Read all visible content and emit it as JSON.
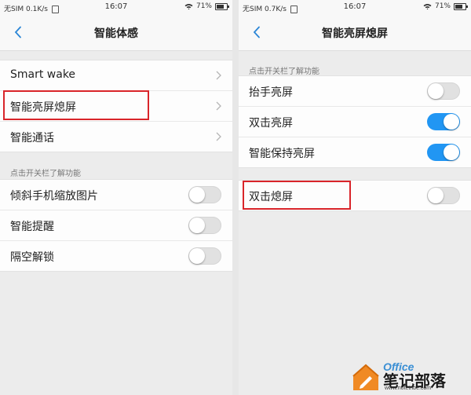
{
  "left_screen": {
    "status": {
      "carrier": "无SIM",
      "speed": "0.1K/s",
      "time": "16:07",
      "battery": "71%",
      "battery_level": 0.71
    },
    "title": "智能体感",
    "nav_items": [
      {
        "label": "Smart wake"
      },
      {
        "label": "智能亮屏熄屏"
      },
      {
        "label": "智能通话"
      }
    ],
    "section_hint": "点击开关栏了解功能",
    "toggle_items": [
      {
        "label": "倾斜手机缩放图片",
        "on": false
      },
      {
        "label": "智能提醒",
        "on": false
      },
      {
        "label": "隔空解锁",
        "on": false
      }
    ]
  },
  "right_screen": {
    "status": {
      "carrier": "无SIM",
      "speed": "0.7K/s",
      "time": "16:07",
      "battery": "71%",
      "battery_level": 0.71
    },
    "title": "智能亮屏熄屏",
    "section_hint": "点击开关栏了解功能",
    "toggle_items": [
      {
        "label": "抬手亮屏",
        "on": false
      },
      {
        "label": "双击亮屏",
        "on": true
      },
      {
        "label": "智能保持亮屏",
        "on": true
      }
    ],
    "extra_toggle": {
      "label": "双击熄屏",
      "on": false
    }
  },
  "colors": {
    "accent": "#2196f3",
    "highlight": "#d9252a"
  },
  "watermark": {
    "office": "Office",
    "main": "笔记部落",
    "url": "www.notetribe.com"
  }
}
